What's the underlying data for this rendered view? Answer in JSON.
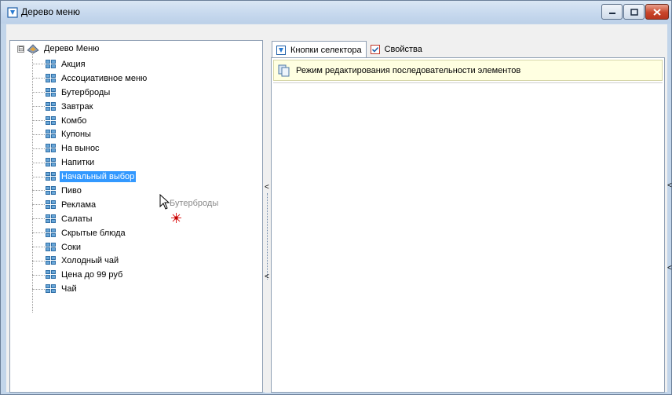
{
  "window": {
    "title": "Дерево меню"
  },
  "tabs": [
    {
      "label": "Кнопки селектора",
      "active": true
    },
    {
      "label": "Свойства",
      "active": false
    }
  ],
  "hint": {
    "text": "Режим редактирования последовательности элементов"
  },
  "tree": {
    "root": {
      "label": "Дерево Меню",
      "expander": "⊟"
    },
    "items": [
      {
        "label": "Акция"
      },
      {
        "label": "Ассоциативное меню"
      },
      {
        "label": "Бутерброды"
      },
      {
        "label": "Завтрак"
      },
      {
        "label": "Комбо"
      },
      {
        "label": "Купоны"
      },
      {
        "label": "На вынос"
      },
      {
        "label": "Напитки"
      },
      {
        "label": "Начальный выбор",
        "selected": true
      },
      {
        "label": "Пиво"
      },
      {
        "label": "Реклама"
      },
      {
        "label": "Салаты"
      },
      {
        "label": "Скрытые блюда"
      },
      {
        "label": "Соки"
      },
      {
        "label": "Холодный чай"
      },
      {
        "label": "Цена до 99 руб"
      },
      {
        "label": "Чай"
      }
    ],
    "drag_ghost": "Бутерброды"
  },
  "splitter": {
    "arrow": "<"
  },
  "colors": {
    "selection": "#3399ff",
    "hint_bg": "#ffffe1",
    "titlebar": "#c7d9ee"
  }
}
